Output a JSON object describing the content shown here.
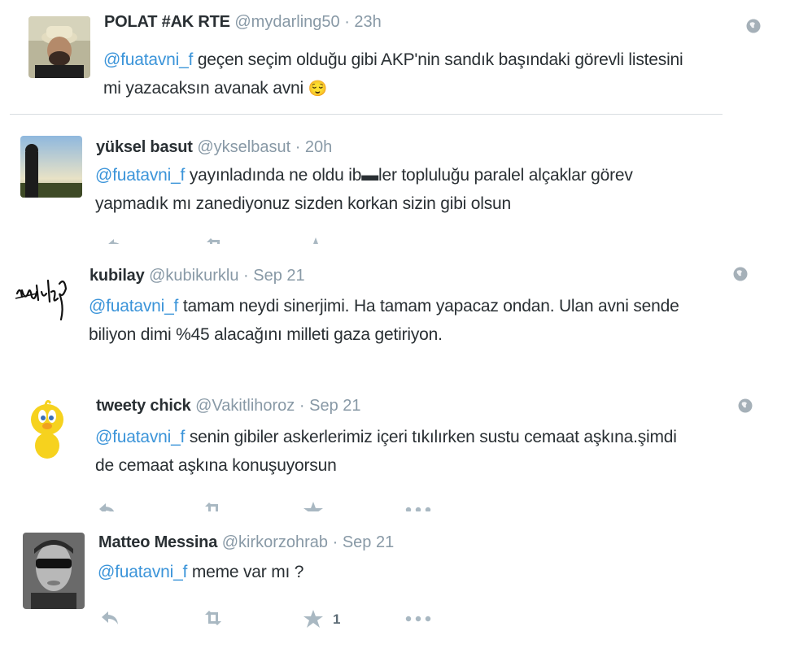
{
  "tweets": [
    {
      "name": "POLAT #AK RTE",
      "handle": "@mydarling50",
      "separator": "·",
      "time": "23h",
      "mention": "@fuatavni_f",
      "text_line1": " geçen seçim olduğu gibi AKP'nin sandık başındaki görevli listesini",
      "text_line2": "mi yazacaksın avanak avni",
      "emoji": "😌"
    },
    {
      "name": "yüksel basut",
      "handle": "@ykselbasut",
      "separator": "·",
      "time": "20h",
      "mention": "@fuatavni_f",
      "text_line1": " yayınladında ne oldu ib▬ler topluluğu paralel alçaklar görev",
      "text_line2": "yapmadık mı zanediyonuz sizden korkan sizin gibi olsun"
    },
    {
      "name": "kubilay",
      "handle": "@kubikurklu",
      "separator": "·",
      "time": "Sep 21",
      "mention": "@fuatavni_f",
      "text_line1": " tamam neydi sinerjimi. Ha tamam yapacaz ondan. Ulan avni sende",
      "text_line2": "biliyon dimi %45 alacağını milleti gaza getiriyon.",
      "avatar_signature": "Kubilay"
    },
    {
      "name": "tweety chick",
      "handle": "@Vakitlihoroz",
      "separator": "·",
      "time": "Sep 21",
      "mention": "@fuatavni_f",
      "text_line1": " senin gibiler askerlerimiz içeri tıkılırken sustu cemaat aşkına.şimdi",
      "text_line2": "de cemaat aşkına konuşuyorsun"
    },
    {
      "name": "Matteo Messina",
      "handle": "@kirkorzohrab",
      "separator": "·",
      "time": "Sep 21",
      "mention": "@fuatavni_f",
      "text_line1": " meme var mı ?",
      "favorite_count": "1"
    }
  ],
  "icons": {
    "reply": "reply-icon",
    "retweet": "retweet-icon",
    "favorite": "star-icon",
    "more": "more-icon",
    "globe": "globe-icon"
  },
  "colors": {
    "link": "#3b94d9",
    "secondary_text": "#8899a6",
    "action_icon": "#a9b8c2",
    "divider": "#d8dde1"
  }
}
